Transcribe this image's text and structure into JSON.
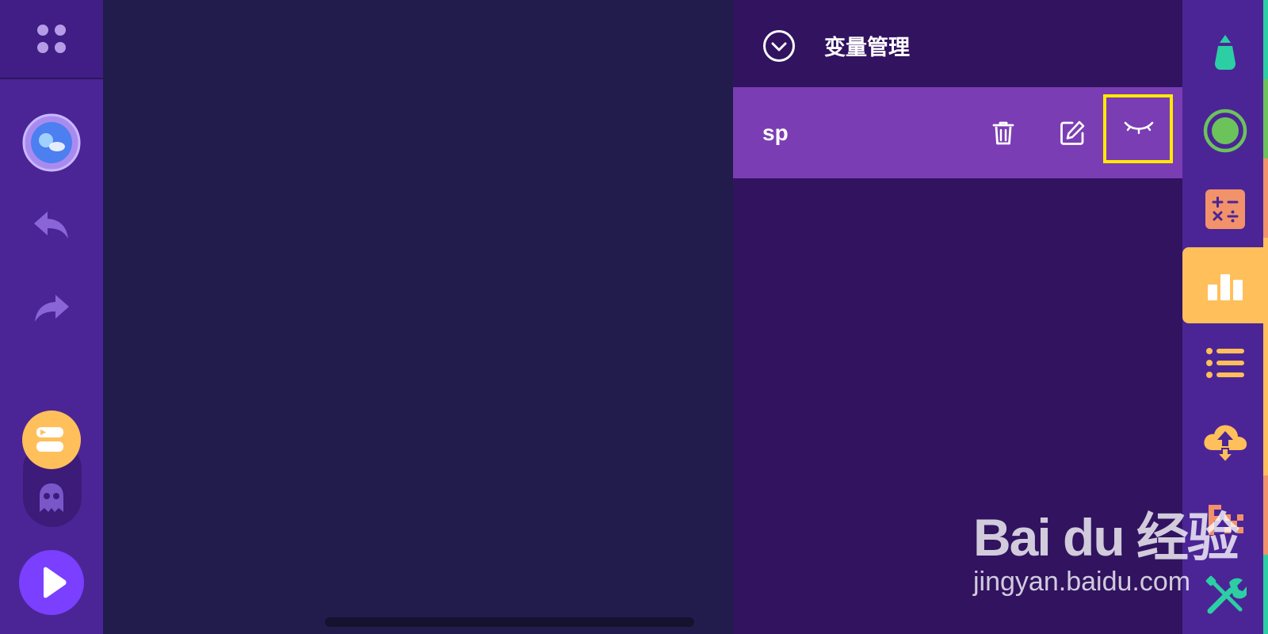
{
  "panel": {
    "title": "变量管理",
    "variables": [
      {
        "name": "sp"
      }
    ]
  },
  "right_rail": {
    "categories": [
      {
        "icon": "pen-icon"
      },
      {
        "icon": "circle-icon"
      },
      {
        "icon": "math-icon"
      },
      {
        "icon": "variables-bar-chart-icon",
        "selected": true
      },
      {
        "icon": "list-icon"
      },
      {
        "icon": "cloud-icon"
      },
      {
        "icon": "functions-icon"
      },
      {
        "icon": "tools-icon"
      }
    ]
  },
  "watermark": {
    "logo": "Bai du 经验",
    "url": "jingyan.baidu.com"
  },
  "colors": {
    "accent_yellow": "#ffea00",
    "selected_category": "#ffbf5b",
    "panel_bg": "#311360",
    "row_bg": "#7b3db3",
    "sidebar_bg": "#4b2596",
    "canvas_bg": "#221c4d"
  }
}
